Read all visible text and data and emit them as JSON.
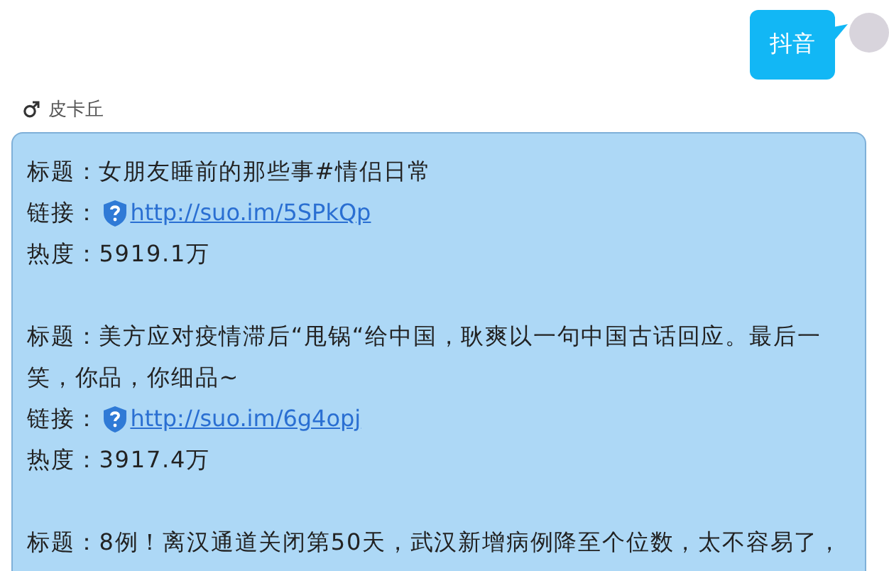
{
  "sent_message": {
    "text": "抖音"
  },
  "sender": {
    "name": "皮卡丘"
  },
  "reply": {
    "entries": [
      {
        "title": "标题：女朋友睡前的那些事#情侣日常",
        "link_label": "链接：",
        "url": "http://suo.im/5SPkQp",
        "heat": "热度：5919.1万"
      },
      {
        "title": "标题：美方应对疫情滞后“甩锅“给中国，耿爽以一句中国古话回应。最后一笑，你品，你细品~",
        "link_label": "链接：",
        "url": "http://suo.im/6g4opj",
        "heat": "热度：3917.4万"
      },
      {
        "title": "标题：8例！离汉通道关闭第50天，武汉新增病例降至个位数，太不容易了，"
      }
    ]
  }
}
